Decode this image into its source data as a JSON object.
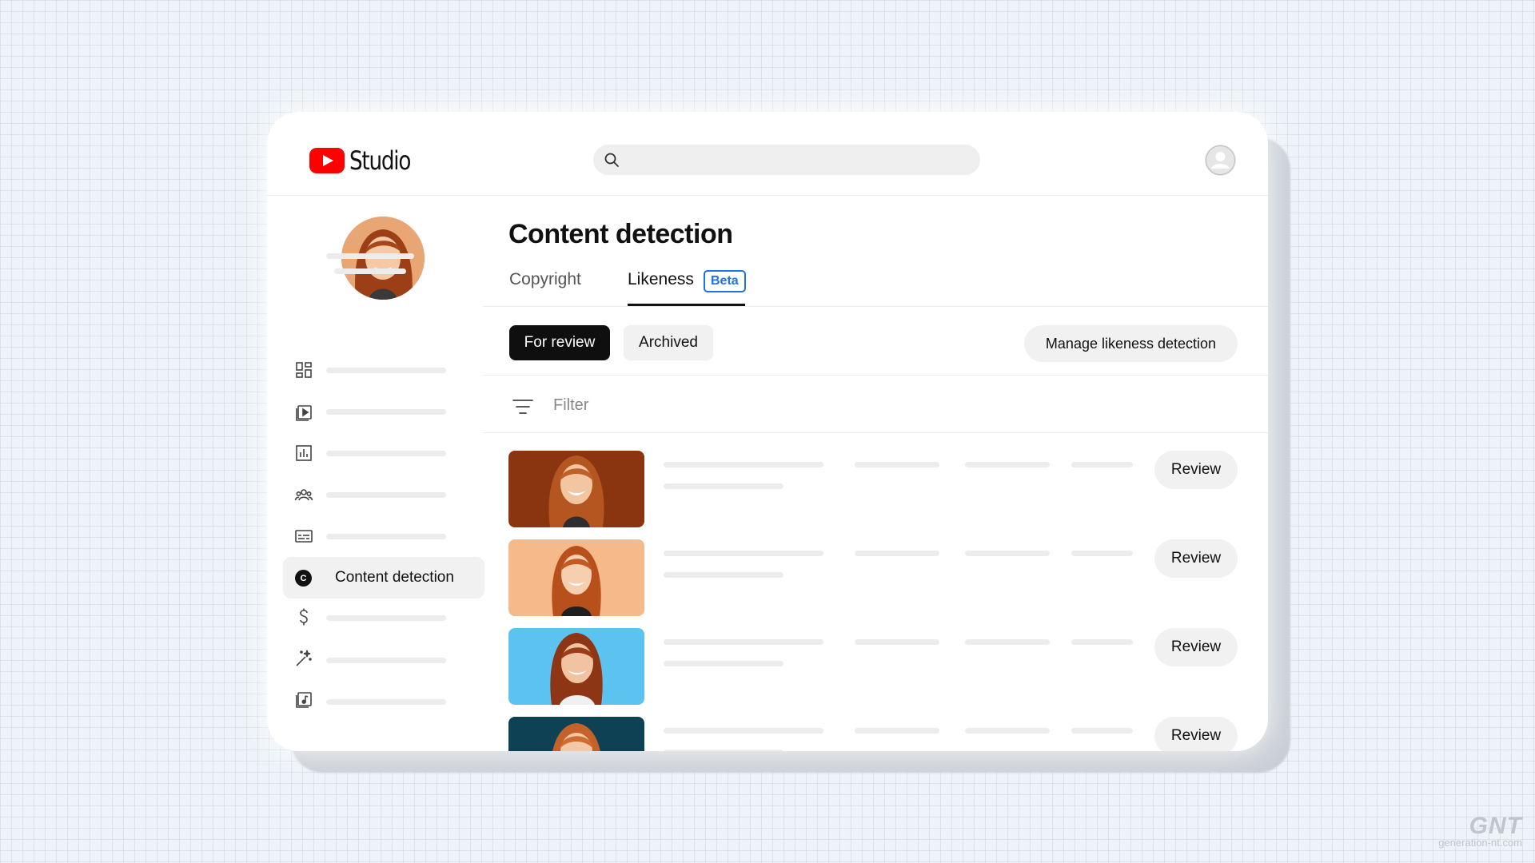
{
  "app": {
    "logo_text": "Studio",
    "icon": "youtube-play-icon"
  },
  "header": {
    "search_placeholder": ""
  },
  "sidebar": {
    "icons": [
      "dashboard-icon",
      "content-icon",
      "analytics-icon",
      "community-icon",
      "subtitles-icon",
      "content-detection-icon",
      "earn-icon",
      "customization-icon",
      "audio-library-icon"
    ],
    "active_item": {
      "label": "Content detection",
      "icon_glyph": "C"
    }
  },
  "main": {
    "title": "Content detection",
    "tabs": [
      {
        "label": "Copyright",
        "active": false
      },
      {
        "label": "Likeness",
        "active": true,
        "badge": "Beta"
      }
    ],
    "filter_buttons": [
      {
        "label": "For review",
        "active": true
      },
      {
        "label": "Archived",
        "active": false
      }
    ],
    "manage_button": "Manage likeness detection",
    "filter_label": "Filter",
    "rows": [
      {
        "thumb_bg": "#8a3410",
        "action": "Review"
      },
      {
        "thumb_bg": "#f6b98a",
        "action": "Review"
      },
      {
        "thumb_bg": "#5cc3f0",
        "action": "Review"
      },
      {
        "thumb_bg": "#0f4154",
        "action": "Review"
      }
    ]
  },
  "colors": {
    "brand": "#ff0000",
    "accent": "#1a73e8",
    "primary_dark": "#0f0f0f"
  },
  "watermark": {
    "mark": "GNT",
    "site": "generation-nt.com"
  }
}
